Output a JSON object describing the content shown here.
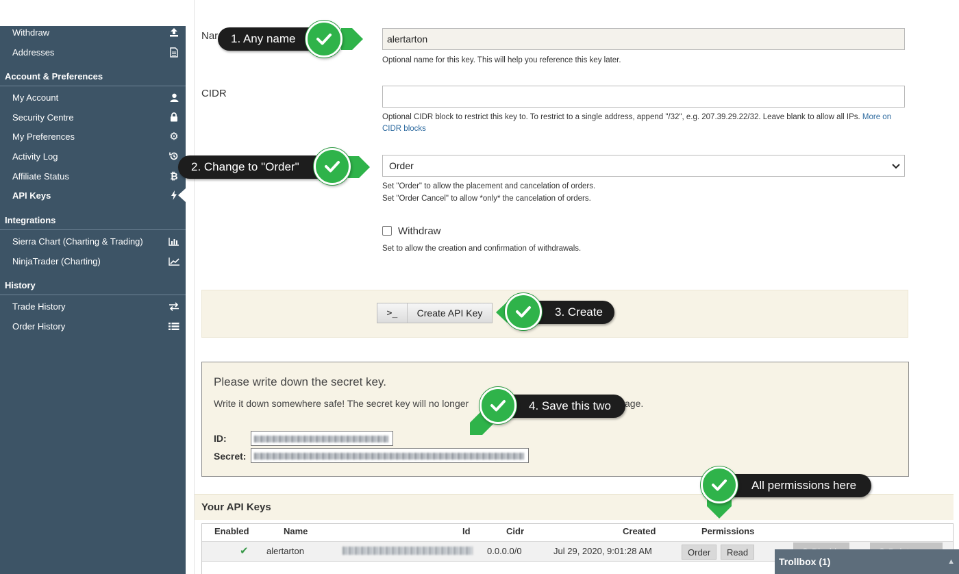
{
  "sidebar": {
    "items_top": [
      {
        "label": "Withdraw",
        "icon": "upload-icon"
      },
      {
        "label": "Addresses",
        "icon": "document-icon"
      }
    ],
    "sections": [
      {
        "title": "Account & Preferences",
        "items": [
          {
            "label": "My Account",
            "icon": "user-icon"
          },
          {
            "label": "Security Centre",
            "icon": "lock-icon"
          },
          {
            "label": "My Preferences",
            "icon": "gear-icon"
          },
          {
            "label": "Activity Log",
            "icon": "history-icon"
          },
          {
            "label": "Affiliate Status",
            "icon": "bitcoin-icon"
          },
          {
            "label": "API Keys",
            "icon": "bolt-icon",
            "active": true
          }
        ]
      },
      {
        "title": "Integrations",
        "items": [
          {
            "label": "Sierra Chart (Charting & Trading)",
            "icon": "bar-chart-icon"
          },
          {
            "label": "NinjaTrader (Charting)",
            "icon": "line-chart-icon"
          }
        ]
      },
      {
        "title": "History",
        "items": [
          {
            "label": "Trade History",
            "icon": "exchange-icon"
          },
          {
            "label": "Order History",
            "icon": "list-icon"
          }
        ]
      }
    ]
  },
  "form": {
    "name_label": "Nar",
    "name_value": "alertarton",
    "name_help": "Optional name for this key. This will help you reference this key later.",
    "cidr_label": "CIDR",
    "cidr_value": "",
    "cidr_help": "Optional CIDR block to restrict this key to. To restrict to a single address, append \"/32\", e.g. 207.39.29.22/32. Leave blank to allow all IPs.",
    "cidr_link": "More on CIDR blocks",
    "permission_value": "Order",
    "permission_help_1": "Set \"Order\" to allow the placement and cancelation of orders.",
    "permission_help_2": "Set \"Order Cancel\" to allow *only* the cancelation of orders.",
    "withdraw_label": "Withdraw",
    "withdraw_checked": false,
    "withdraw_help": "Set to allow the creation and confirmation of withdrawals.",
    "create_button": "Create API Key",
    "create_button_prompt": ">_"
  },
  "secret": {
    "title": "Please write down the secret key.",
    "note_part1": "Write it down somewhere safe! The secret key will no longer",
    "note_part2": "age.",
    "id_label": "ID:",
    "secret_label": "Secret:"
  },
  "keys": {
    "header": "Your API Keys",
    "columns": [
      "Enabled",
      "Name",
      "Id",
      "Cidr",
      "Created",
      "Permissions"
    ],
    "rows": [
      {
        "enabled": "✔",
        "name": "alertarton",
        "cidr": "0.0.0.0/0",
        "created": "Jul 29, 2020, 9:01:28 AM",
        "permissions": [
          "Order",
          "Read"
        ],
        "disable_label": "Disable",
        "delete_label": "Delete"
      }
    ]
  },
  "trollbox": {
    "label": "Trollbox (1)"
  },
  "callouts": {
    "step1": "1. Any name",
    "step2": "2. Change to \"Order\"",
    "step3": "3. Create",
    "step4": "4. Save this two",
    "step5": "All permissions here"
  },
  "colors": {
    "sidebar": "#3d5466",
    "panel": "#f7f3e6",
    "callout": "#1d1d1d",
    "check_green": "#2fb34a"
  }
}
